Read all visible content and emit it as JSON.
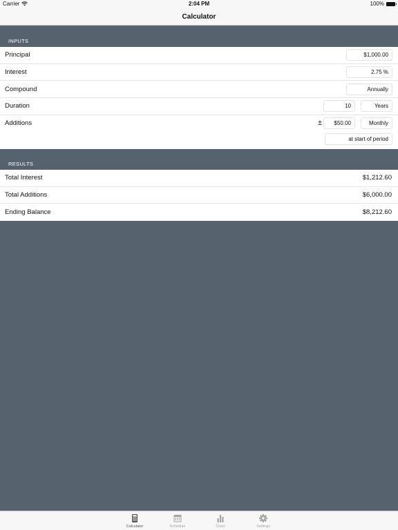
{
  "status_bar": {
    "carrier": "Carrier",
    "time": "2:04 PM",
    "battery": "100%"
  },
  "nav": {
    "title": "Calculator"
  },
  "inputs": {
    "header": "INPUTS",
    "principal": {
      "label": "Principal",
      "value": "$1,000.00"
    },
    "interest": {
      "label": "Interest",
      "value": "2.75 %"
    },
    "compound": {
      "label": "Compound",
      "value": "Annually"
    },
    "duration": {
      "label": "Duration",
      "value": "10",
      "unit": "Years"
    },
    "additions": {
      "label": "Additions",
      "sign": "±",
      "amount": "$50.00",
      "frequency": "Monthly",
      "timing": "at start of period"
    }
  },
  "results": {
    "header": "RESULTS",
    "total_interest": {
      "label": "Total Interest",
      "value": "$1,212.60"
    },
    "total_additions": {
      "label": "Total Additions",
      "value": "$6,000.00"
    },
    "ending_balance": {
      "label": "Ending Balance",
      "value": "$8,212.60"
    }
  },
  "tabs": [
    {
      "label": "Calculator",
      "icon": "calculator-icon",
      "active": true
    },
    {
      "label": "Schedule",
      "icon": "calendar-icon",
      "active": false
    },
    {
      "label": "Chart",
      "icon": "bar-chart-icon",
      "active": false
    },
    {
      "label": "Settings",
      "icon": "gear-icon",
      "active": false
    }
  ],
  "colors": {
    "background": "#56636f",
    "bar": "#f7f7f7",
    "active_tab": "#555555",
    "inactive_tab": "#a6a6a6"
  }
}
